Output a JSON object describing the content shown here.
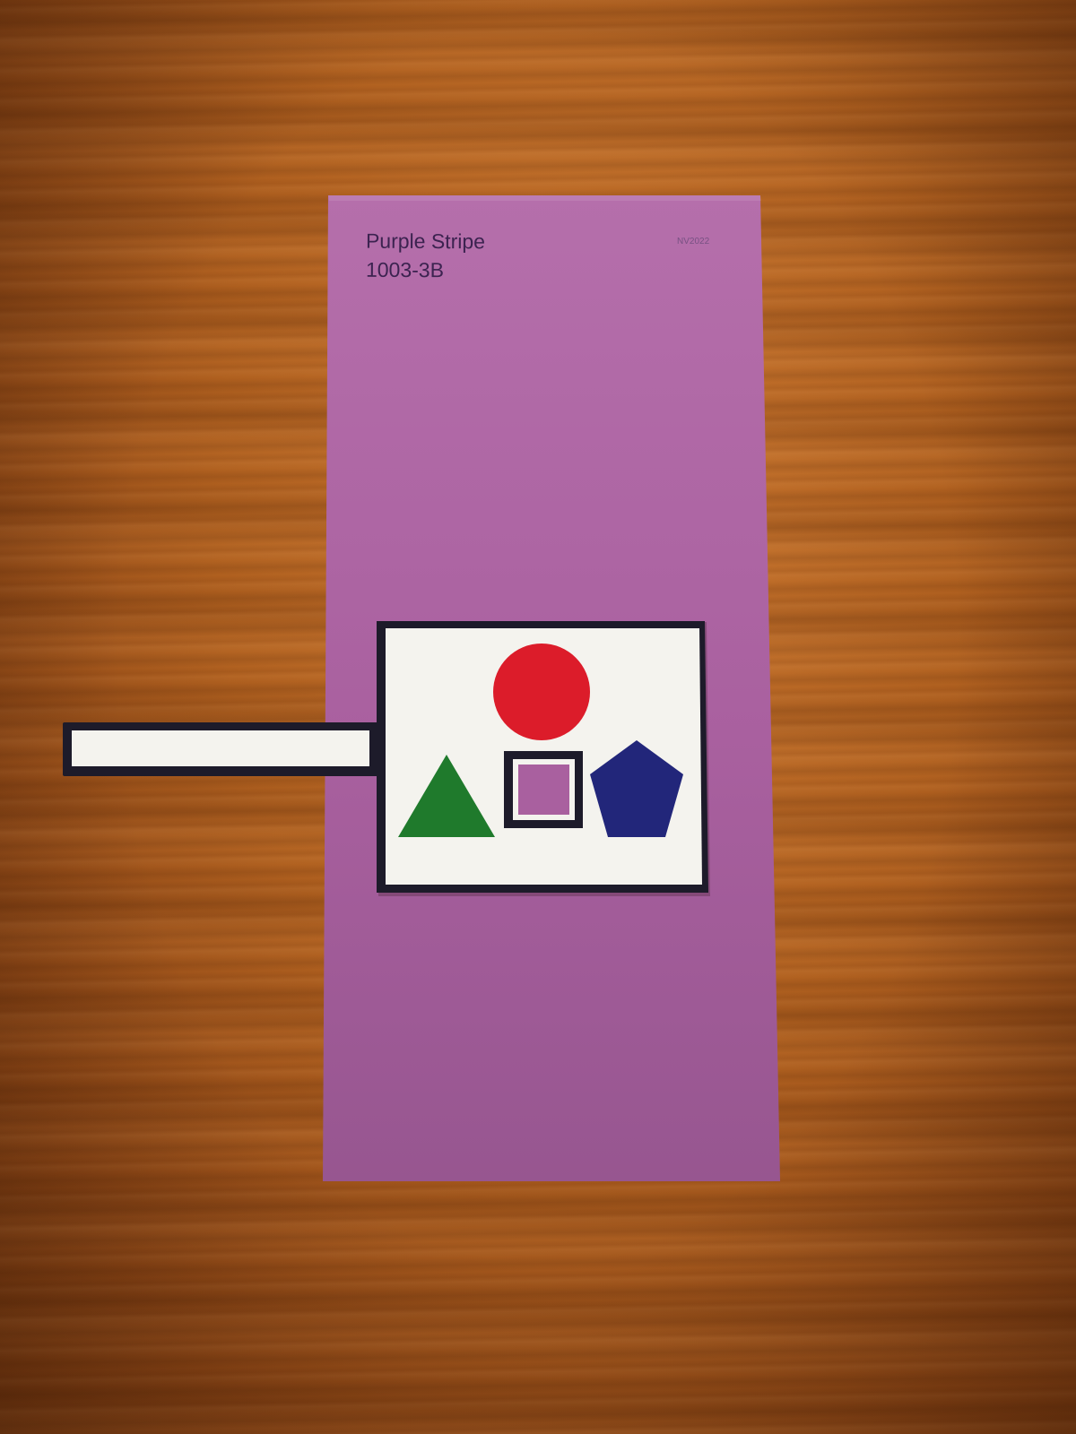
{
  "scene": {
    "surface": "wooden table",
    "wood_color": "#b0601f"
  },
  "paint_card": {
    "name": "Purple Stripe",
    "code": "1003-3B",
    "brand_mark": "NV2022",
    "color": "#b36aa8"
  },
  "shape_card": {
    "background": "#f4f3ee",
    "border_color": "#1d1b2a",
    "shapes": [
      {
        "name": "circle",
        "color": "#dc1c2a"
      },
      {
        "name": "triangle",
        "color": "#1f7a2c"
      },
      {
        "name": "square-window",
        "color": "#b36aa8"
      },
      {
        "name": "pentagon",
        "color": "#22267a"
      }
    ]
  },
  "pull_tab": {
    "color": "#f4f3ee",
    "border_color": "#1d1b2a"
  }
}
